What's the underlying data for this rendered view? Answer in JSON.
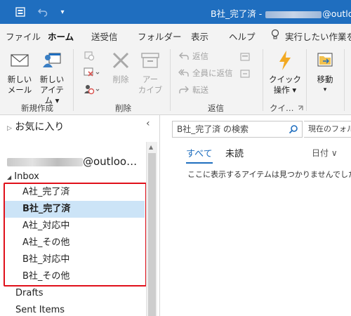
{
  "titlebar": {
    "title_prefix": "B社_完了済 - ",
    "title_suffix": "@outlook",
    "accent": "#1f6ebf"
  },
  "ribbon_tabs": [
    "ファイル",
    "ホーム",
    "送受信",
    "フォルダー",
    "表示",
    "ヘルプ",
    "実行したい作業を"
  ],
  "ribbon": {
    "new_mail": [
      "新しい",
      "メール"
    ],
    "new_items": [
      "新しい",
      "アイテム ▾"
    ],
    "group_new": "新規作成",
    "delete": "削除",
    "archive": [
      "アー",
      "カイブ"
    ],
    "group_delete": "削除",
    "reply": "返信",
    "reply_all": "全員に返信",
    "forward": "転送",
    "group_respond": "返信",
    "quick_steps": [
      "クイック",
      "操作 ▾"
    ],
    "group_quick": "クイ…",
    "move": "移動",
    "move_arrow": "▾"
  },
  "folder_pane": {
    "favorites": "お気に入り",
    "account_suffix": "@outloo…",
    "inbox": "Inbox",
    "subfolders": [
      "A社_完了済",
      "B社_完了済",
      "A社_対応中",
      "A社_その他",
      "B社_対応中",
      "B社_その他"
    ],
    "selected_index": 1,
    "other_folders": [
      "Drafts",
      "Sent Items"
    ]
  },
  "message_list": {
    "search_placeholder": "B社_完了済 の検索",
    "scope": "現在のフォルダー",
    "tab_all": "すべて",
    "tab_unread": "未読",
    "sort": "日付 ∨",
    "empty_message": "ここに表示するアイテムは見つかりませんでした。"
  }
}
